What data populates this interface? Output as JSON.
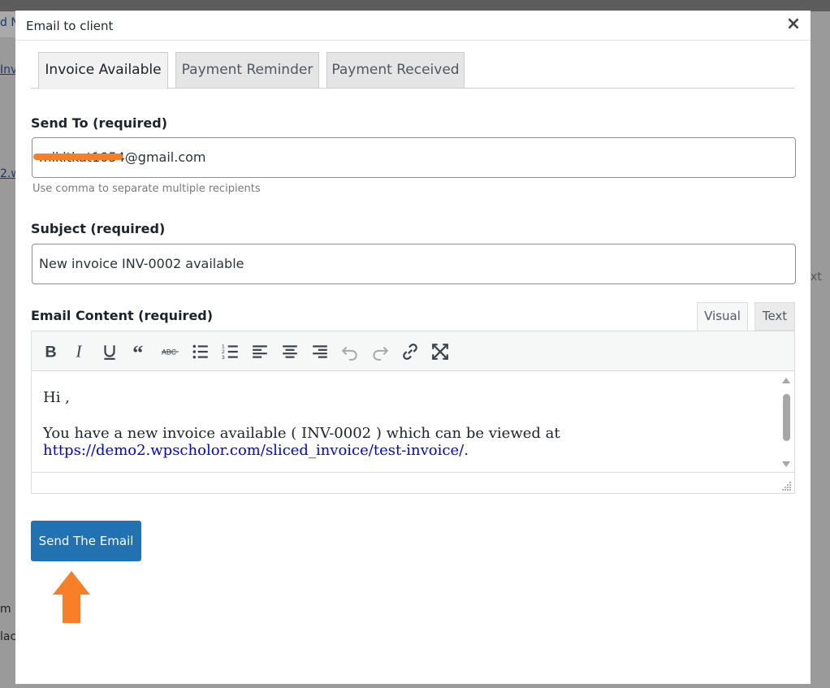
{
  "modal": {
    "title": "Email to client",
    "close_glyph": "×"
  },
  "tabs": [
    {
      "label": "Invoice Available",
      "active": true
    },
    {
      "label": "Payment Reminder",
      "active": false
    },
    {
      "label": "Payment Received",
      "active": false
    }
  ],
  "send_to": {
    "label": "Send To (required)",
    "value": "mikitkat1054@gmail.com",
    "help": "Use comma to separate multiple recipients"
  },
  "subject": {
    "label": "Subject (required)",
    "value": "New invoice INV-0002 available"
  },
  "email_content": {
    "label": "Email Content (required)",
    "mode_tabs": {
      "visual": "Visual",
      "text": "Text"
    },
    "toolbar_icons": [
      "bold-icon",
      "italic-icon",
      "underline-icon",
      "blockquote-icon",
      "strikethrough-icon",
      "bullet-list-icon",
      "numbered-list-icon",
      "align-left-icon",
      "align-center-icon",
      "align-right-icon",
      "undo-icon",
      "redo-icon",
      "link-icon",
      "fullscreen-icon"
    ],
    "body": {
      "greeting": "Hi ,",
      "line_text": "You have a new invoice available ( INV-0002 ) which can be viewed at",
      "link": "https://demo2.wpscholor.com/sliced_invoice/test-invoice/",
      "link_suffix": "."
    }
  },
  "send_button": {
    "label": "Send The Email"
  },
  "annotation_color": "#f97f27",
  "primary_color": "#2271b1",
  "background_fragments": [
    "d N",
    "Inv",
    "2.w",
    "xt",
    "m",
    "lac"
  ]
}
